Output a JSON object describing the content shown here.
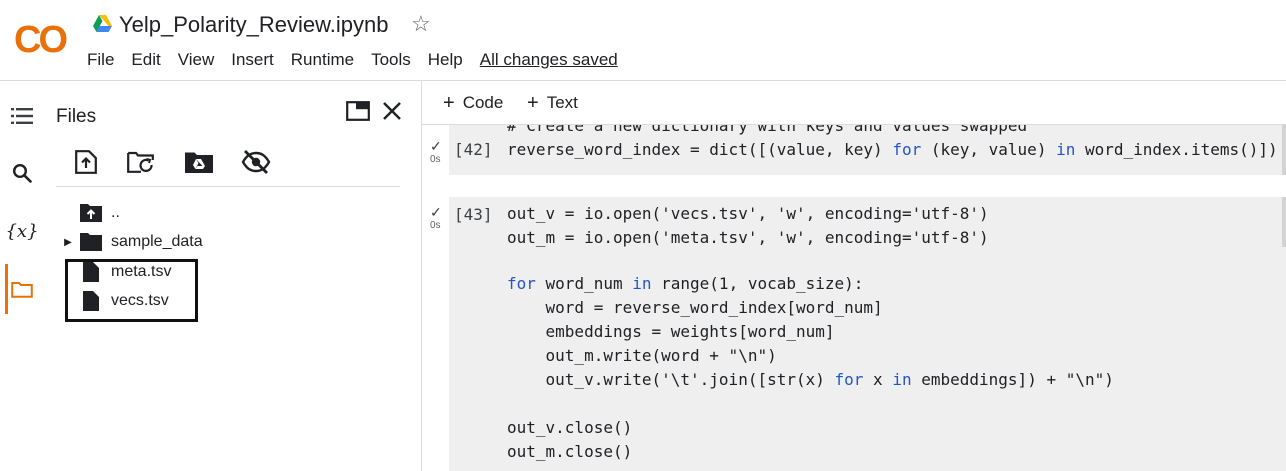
{
  "header": {
    "logo_text": "CO",
    "notebook_title": "Yelp_Polarity_Review.ipynb",
    "star_glyph": "☆",
    "menu": [
      "File",
      "Edit",
      "View",
      "Insert",
      "Runtime",
      "Tools",
      "Help"
    ],
    "save_status": "All changes saved",
    "logo_color": "#e8710a"
  },
  "rail": {
    "items": [
      "table-of-contents-icon",
      "search-icon",
      "variables-icon",
      "folder-icon"
    ],
    "variables_label": "{x}",
    "active_item": "folder-icon"
  },
  "files_panel": {
    "title": "Files",
    "toolbar": [
      "upload-icon",
      "new-folder-icon",
      "mount-drive-icon",
      "hide-files-icon"
    ],
    "tree": [
      {
        "name": "..",
        "type": "parent-folder"
      },
      {
        "name": "sample_data",
        "type": "folder"
      },
      {
        "name": "meta.tsv",
        "type": "file"
      },
      {
        "name": "vecs.tsv",
        "type": "file"
      }
    ]
  },
  "notebook": {
    "toolbar": {
      "code_label": "Code",
      "text_label": "Text",
      "plus_glyph": "+"
    },
    "cells": [
      {
        "exec_count": "[42]",
        "status_glyph": "✓",
        "duration": "0s",
        "comment_line": "# Create a new dictionary with keys and values swapped",
        "code_line": {
          "p1": "reverse_word_index = dict([(value, key) ",
          "k1": "for",
          "p2": " (key, value) ",
          "k2": "in",
          "p3": " word_index.items()])"
        }
      },
      {
        "exec_count": "[43]",
        "status_glyph": "✓",
        "duration": "0s",
        "lines": {
          "l1": "out_v = io.open('vecs.tsv', 'w', encoding='utf-8')",
          "l2": "out_m = io.open('meta.tsv', 'w', encoding='utf-8')",
          "l4_kw1": "for",
          "l4_mid": " word_num ",
          "l4_kw2": "in",
          "l4_end": " range(1, vocab_size):",
          "l5": "    word = reverse_word_index[word_num]",
          "l6": "    embeddings = weights[word_num]",
          "l7": "    out_m.write(word + \"\\n\")",
          "l8_a": "    out_v.write('\\t'.join([str(x) ",
          "l8_kw1": "for",
          "l8_b": " x ",
          "l8_kw2": "in",
          "l8_c": " embeddings]) + \"\\n\")",
          "l10": "out_v.close()",
          "l11": "out_m.close()"
        }
      }
    ]
  }
}
